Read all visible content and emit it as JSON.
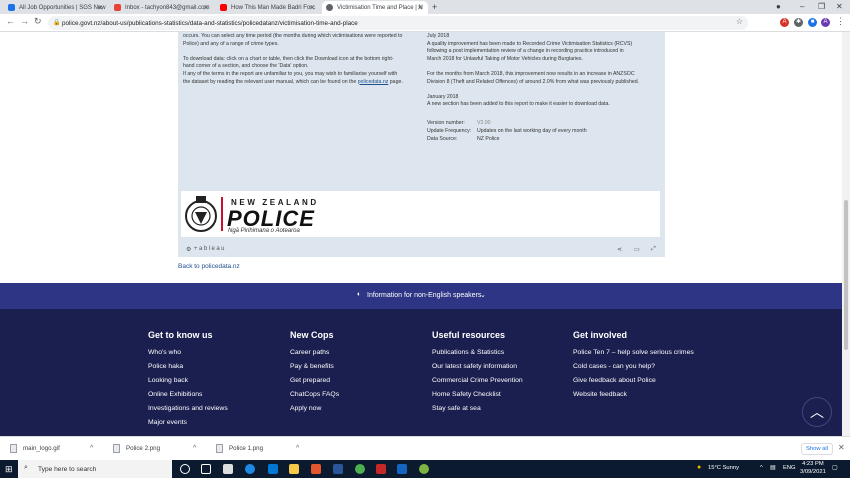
{
  "browser": {
    "tabs": [
      {
        "title": "All Job Opportunities | SGS New",
        "active": false,
        "color": "#1a73e8"
      },
      {
        "title": "Inbox - tachyon843@gmail.com",
        "active": false,
        "color": "#ea4335"
      },
      {
        "title": "How This Man Made Badri Forc",
        "active": false,
        "color": "#ff0000"
      },
      {
        "title": "Victimisation Time and Place | N",
        "active": true,
        "color": "#5f6368"
      }
    ],
    "url": "police.govt.nz/about-us/publications-statistics/data-and-statistics/policedatanz/victimisation-time-and-place"
  },
  "tableau": {
    "left_text": [
      "occurs. You can select any time period (the months during which victimisations were reported to",
      "Police) and any of a range of crime types.",
      "",
      "To download data: click on a chart or table, then click the Download icon at the bottom right-",
      "hand corner of a section, and choose the 'Data' option.",
      "If any of the terms in the report are unfamiliar to you, you may wish to familiarise yourself with",
      "the dataset by reading the relevant user manual, which can be found on the"
    ],
    "left_link": "policedata.nz",
    "left_link_suffix": " page.",
    "right_text": [
      "July 2018",
      "A quality improvement has been made to Recorded Crime Victimisation Statistics (RCVS)",
      "following a post implementation review of a change in recording practice introduced in",
      "March 2018 for Unlawful Taking of Motor Vehicles during Burglaries.",
      "",
      "For the months from March 2018, this improvement now results in an increase in ANZSOC",
      "Division 8 (Theft and Related Offences) of around 2.0% from what was previously published.",
      "",
      "January 2018",
      "A new section has been added to this report to make it easier to download data."
    ],
    "meta": [
      {
        "key": "Version number:",
        "value": "V2.00"
      },
      {
        "key": "Update Frequency:",
        "value": "Updates on the last working day of every month"
      },
      {
        "key": "Data Source:",
        "value": "NZ Police"
      }
    ],
    "logo": {
      "line1": "NEW ZEALAND",
      "line2": "POLICE",
      "line3": "Ngā Pirihimana o Aotearoa"
    },
    "footer_brand": "+ableau"
  },
  "back_link": "Back to policedata.nz",
  "info_band": "Information for non-English speakers",
  "footer": {
    "columns": [
      {
        "heading": "Get to know us",
        "items": [
          "Who's who",
          "Police haka",
          "Looking back",
          "Online Exhibitions",
          "Investigations and reviews",
          "Major events"
        ]
      },
      {
        "heading": "New Cops",
        "items": [
          "Career paths",
          "Pay & benefits",
          "Get prepared",
          "ChatCops FAQs",
          "Apply now"
        ]
      },
      {
        "heading": "Useful resources",
        "items": [
          "Publications & Statistics",
          "Our latest safety information",
          "Commercial Crime Prevention",
          "Home Safety Checklist",
          "Stay safe at sea"
        ]
      },
      {
        "heading": "Get involved",
        "items": [
          "Police Ten 7 – help solve serious crimes",
          "Cold cases - can you help?",
          "Give feedback about Police",
          "Website feedback"
        ]
      }
    ]
  },
  "downloads": {
    "items": [
      "main_logo.gif",
      "Police 2.png",
      "Police 1.png"
    ],
    "show_all": "Show all"
  },
  "taskbar": {
    "search_placeholder": "Type here to search",
    "weather": "15°C  Sunny",
    "language": "ENG",
    "time": "4:23 PM",
    "date": "3/09/2021"
  }
}
